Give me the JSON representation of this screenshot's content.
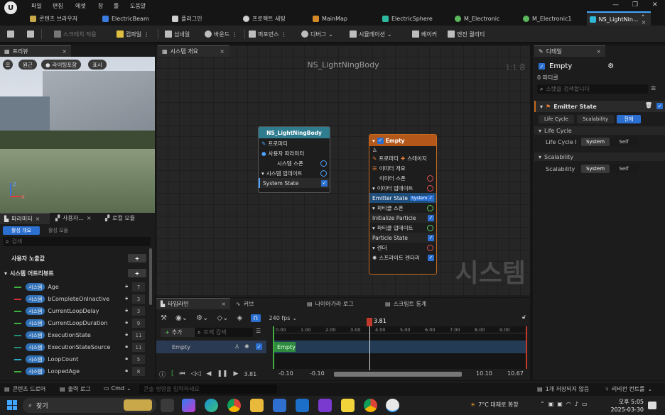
{
  "menu": {
    "items": [
      "파일",
      "편집",
      "에셋",
      "창",
      "툴",
      "도움말"
    ]
  },
  "tabs": [
    {
      "label": "콘텐츠 브라우저",
      "color": "#c9a84a"
    },
    {
      "label": "ElectricBeam",
      "color": "#3a7be0"
    },
    {
      "label": "플러그인",
      "color": "#cfcfcf"
    },
    {
      "label": "프로젝트 세팅",
      "color": "#cfcfcf"
    },
    {
      "label": "MainMap",
      "color": "#d58a2a"
    },
    {
      "label": "ElectricSphere",
      "color": "#2fb8a0"
    },
    {
      "label": "M_Electronic",
      "color": "#5cb85c"
    },
    {
      "label": "M_Electronic1",
      "color": "#5cb85c"
    },
    {
      "label": "NS_LightNin...",
      "color": "#2fb8d8"
    }
  ],
  "toolbar": {
    "save": "",
    "browse": "",
    "apply_scratch": "스크래치 적용",
    "compile": "컴파일",
    "thumbnail": "섬네일",
    "bounds": "바운드",
    "performance": "퍼포먼스",
    "debug": "디버그",
    "simulation": "시뮬레이션",
    "bake": "베이커",
    "engine_scalability": "엔진 퀄리티"
  },
  "preview": {
    "tab": "프리뷰",
    "btn_perspective": "원근",
    "btn_lighting": "라이팅포함",
    "btn_show": "표시",
    "axis_z": "Z",
    "axis_x": "X"
  },
  "params": {
    "tabs": [
      "파라미터",
      "사용자...",
      "로컬 모듈"
    ],
    "sub_tabs": [
      "활성 개요",
      "활성 모듈"
    ],
    "search_placeholder": "검색",
    "section_user": "사용자 노출값",
    "section_system": "시스템 어트리뷰트",
    "badge": "시스템",
    "rows": [
      {
        "name": "Age",
        "value": "7",
        "color": "#3db13d"
      },
      {
        "name": "bCompleteOnInactive",
        "value": "3",
        "color": "#d23030"
      },
      {
        "name": "CurrentLoopDelay",
        "value": "3",
        "color": "#3db13d"
      },
      {
        "name": "CurrentLoopDuration",
        "value": "9",
        "color": "#3db13d"
      },
      {
        "name": "ExecutionState",
        "value": "11",
        "color": "#1f8f7a"
      },
      {
        "name": "ExecutionStateSource",
        "value": "11",
        "color": "#1f8f7a"
      },
      {
        "name": "LoopCount",
        "value": "5",
        "color": "#2aa8c8"
      },
      {
        "name": "LoopedAge",
        "value": "8",
        "color": "#3db13d"
      }
    ]
  },
  "graph": {
    "tab": "시스템 개요",
    "title": "NS_LightNingBody",
    "zoom": "1:1 줌",
    "watermark": "시스템",
    "node1": {
      "title": "NS_LightNingBody",
      "rows": [
        "프로퍼티",
        "사용자 파라미터",
        "시스템 스폰",
        "시스템 업데이트",
        "System State"
      ]
    },
    "node2": {
      "title": "Empty",
      "rows": [
        "프로퍼티",
        "스테이지",
        "이미터 개요",
        "이미터 스폰",
        "이미터 업데이트",
        "Emitter State",
        "System",
        "파티클 스폰",
        "Initialize Particle",
        "파티클 업데이트",
        "Particle State",
        "렌더",
        "스프라이트 렌더러"
      ]
    }
  },
  "timeline": {
    "tabs": [
      "타임라인",
      "커브",
      "나이아가라 로그",
      "스크립트 통계"
    ],
    "fps": "240 fps",
    "add": "추가",
    "track_search": "트랙 검색",
    "track": "Empty",
    "clip": "Empty",
    "playhead": "3.81",
    "ticks": [
      "0.00",
      "1.00",
      "2.00",
      "3.00",
      "4.00",
      "5.00",
      "6.00",
      "7.00",
      "8.00",
      "9.00"
    ],
    "start_a": "-0.10",
    "start_b": "-0.10",
    "end_a": "10.10",
    "end_b": "10.67",
    "time_display": "3.81"
  },
  "details": {
    "tab": "디테일",
    "name": "Empty",
    "count": "0 파티클",
    "search_placeholder": "스탯을 검색합니다",
    "section": "Emitter State",
    "seg": [
      "Life Cycle",
      "Scalability",
      "전체"
    ],
    "lifecycle_head": "Life Cycle",
    "lifecycle_row": "Life Cycle I",
    "scal_head": "Scalability",
    "scal_row": "Scalability",
    "opt_system": "System",
    "opt_self": "Self"
  },
  "statusbar": {
    "content_drawer": "콘텐츠 드로어",
    "output_log": "출력 로그",
    "cmd": "Cmd",
    "cmd_placeholder": "콘솔 명령을 입력하세요",
    "unsaved": "1개 저장되지 않음",
    "source_control": "리비전 컨트롤"
  },
  "taskbar": {
    "search": "찾기",
    "weather": "7°C 대체로 화창",
    "time": "오후 5:05",
    "date": "2025-03-30"
  }
}
